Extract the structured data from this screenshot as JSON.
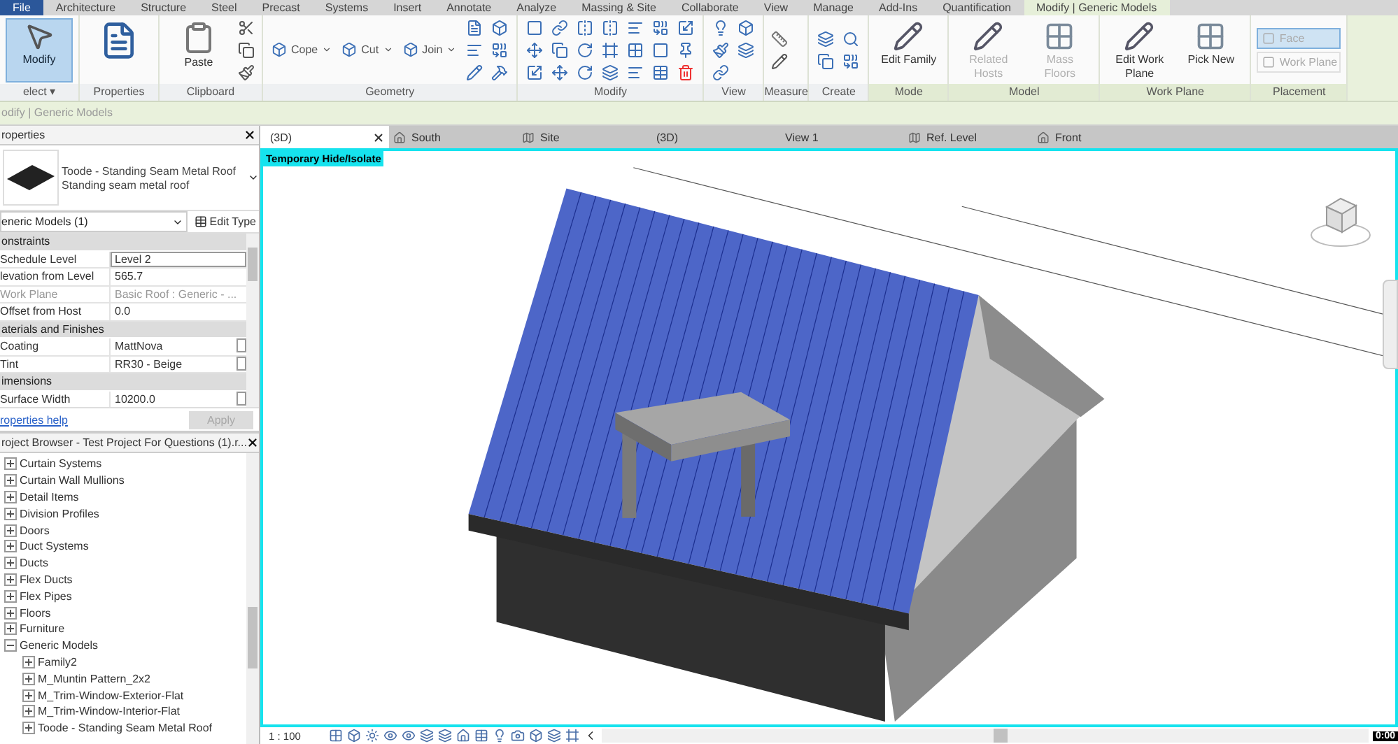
{
  "menu_tabs": [
    {
      "label": "File",
      "kind": "file",
      "selected": false
    },
    {
      "label": "Architecture",
      "kind": "tab",
      "selected": false
    },
    {
      "label": "Structure",
      "kind": "tab",
      "selected": false
    },
    {
      "label": "Steel",
      "kind": "tab",
      "selected": false
    },
    {
      "label": "Precast",
      "kind": "tab",
      "selected": false
    },
    {
      "label": "Systems",
      "kind": "tab",
      "selected": false
    },
    {
      "label": "Insert",
      "kind": "tab",
      "selected": false
    },
    {
      "label": "Annotate",
      "kind": "tab",
      "selected": false
    },
    {
      "label": "Analyze",
      "kind": "tab",
      "selected": false
    },
    {
      "label": "Massing & Site",
      "kind": "tab",
      "selected": false
    },
    {
      "label": "Collaborate",
      "kind": "tab",
      "selected": false
    },
    {
      "label": "View",
      "kind": "tab",
      "selected": false
    },
    {
      "label": "Manage",
      "kind": "tab",
      "selected": false
    },
    {
      "label": "Add-Ins",
      "kind": "tab",
      "selected": false
    },
    {
      "label": "Quantification",
      "kind": "tab",
      "selected": false
    },
    {
      "label": "Modify | Generic Models",
      "kind": "tab",
      "selected": true
    }
  ],
  "ribbon": {
    "panels": [
      {
        "label": "elect ▾",
        "kind": "select",
        "contextual": false,
        "buttons": [
          {
            "kind": "large",
            "label": "Modify",
            "selected": true,
            "disabled": false
          }
        ]
      },
      {
        "label": "Properties",
        "kind": "properties",
        "contextual": false
      },
      {
        "label": "Clipboard",
        "kind": "clipboard",
        "contextual": false,
        "buttons": [
          {
            "kind": "large",
            "label": "Paste",
            "selected": false,
            "disabled": false
          }
        ]
      },
      {
        "label": "Geometry",
        "kind": "geometry",
        "contextual": false,
        "buttons": [
          {
            "kind": "small",
            "label": "Cope"
          },
          {
            "kind": "small",
            "label": "Cut"
          },
          {
            "kind": "small",
            "label": "Join"
          }
        ]
      },
      {
        "label": "Modify",
        "kind": "modify",
        "contextual": false
      },
      {
        "label": "View",
        "kind": "view",
        "contextual": false
      },
      {
        "label": "Measure",
        "kind": "measure",
        "contextual": false
      },
      {
        "label": "Create",
        "kind": "create",
        "contextual": false
      },
      {
        "label": "Mode",
        "kind": "plain",
        "contextual": true,
        "buttons": [
          {
            "kind": "large",
            "label": "Edit Family",
            "selected": false,
            "disabled": false
          }
        ]
      },
      {
        "label": "Model",
        "kind": "plain",
        "contextual": true,
        "buttons": [
          {
            "kind": "large",
            "label": "Related Hosts",
            "selected": false,
            "disabled": true
          },
          {
            "kind": "large",
            "label": "Mass Floors",
            "selected": false,
            "disabled": true
          }
        ]
      },
      {
        "label": "Work Plane",
        "kind": "plain",
        "contextual": true,
        "buttons": [
          {
            "kind": "large",
            "label": "Edit Work Plane",
            "selected": false,
            "disabled": false
          },
          {
            "kind": "large",
            "label": "Pick New",
            "selected": false,
            "disabled": false
          }
        ]
      },
      {
        "label": "Placement",
        "kind": "plain",
        "contextual": true,
        "buttons": [
          {
            "kind": "toggle",
            "label": "Face",
            "selected": true,
            "disabled": true
          },
          {
            "kind": "toggle",
            "label": "Work Plane",
            "selected": false,
            "disabled": true
          }
        ]
      }
    ]
  },
  "context_bar": "odify | Generic Models",
  "properties": {
    "title": "roperties",
    "type_name": "Toode - Standing Seam Metal Roof",
    "type_sub": "Standing seam metal roof",
    "filter": "eneric Models (1)",
    "edit_type": "Edit Type",
    "rows": [
      {
        "kind": "group",
        "label": "onstraints"
      },
      {
        "kind": "param",
        "label": "Schedule Level",
        "value": "Level 2",
        "focused": true,
        "disabled": false
      },
      {
        "kind": "param",
        "label": "levation from Level",
        "value": "565.7",
        "focused": false,
        "disabled": false
      },
      {
        "kind": "param",
        "label": "Work Plane",
        "value": "Basic Roof : Generic - ...",
        "focused": false,
        "disabled": true
      },
      {
        "kind": "param",
        "label": "Offset from Host",
        "value": "0.0",
        "focused": false,
        "disabled": false
      },
      {
        "kind": "group",
        "label": "aterials and Finishes"
      },
      {
        "kind": "param",
        "label": "Coating",
        "value": "MattNova",
        "focused": false,
        "disabled": false,
        "button": true
      },
      {
        "kind": "param",
        "label": "Tint",
        "value": "RR30 - Beige",
        "focused": false,
        "disabled": false,
        "button": true
      },
      {
        "kind": "group",
        "label": "imensions"
      },
      {
        "kind": "param",
        "label": "Surface Width",
        "value": "10200.0",
        "focused": false,
        "disabled": false,
        "button": true
      }
    ],
    "help": "roperties help",
    "apply": "Apply"
  },
  "browser": {
    "title": "roject Browser - Test Project For Questions (1).r...",
    "items": [
      {
        "label": "Curtain Systems",
        "expanded": false
      },
      {
        "label": "Curtain Wall Mullions",
        "expanded": false
      },
      {
        "label": "Detail Items",
        "expanded": false
      },
      {
        "label": "Division Profiles",
        "expanded": false
      },
      {
        "label": "Doors",
        "expanded": false
      },
      {
        "label": "Duct Systems",
        "expanded": false
      },
      {
        "label": "Ducts",
        "expanded": false
      },
      {
        "label": "Flex Ducts",
        "expanded": false
      },
      {
        "label": "Flex Pipes",
        "expanded": false
      },
      {
        "label": "Floors",
        "expanded": false
      },
      {
        "label": "Furniture",
        "expanded": false
      },
      {
        "label": "Generic Models",
        "expanded": true,
        "children": [
          {
            "label": "Family2",
            "expanded": false
          },
          {
            "label": "M_Muntin Pattern_2x2",
            "expanded": false
          },
          {
            "label": "M_Trim-Window-Exterior-Flat",
            "expanded": false
          },
          {
            "label": "M_Trim-Window-Interior-Flat",
            "expanded": false
          },
          {
            "label": "Toode - Standing Seam Metal Roof",
            "expanded": false
          }
        ]
      }
    ]
  },
  "view_tabs": [
    {
      "label": "(3D)",
      "kind": "model",
      "selected": true,
      "closable": true
    },
    {
      "label": "South",
      "kind": "elevation",
      "selected": false
    },
    {
      "label": "Site",
      "kind": "plan",
      "selected": false
    },
    {
      "label": "(3D)",
      "kind": "model",
      "selected": false
    },
    {
      "label": "View 1",
      "kind": "model",
      "selected": false
    },
    {
      "label": "Ref. Level",
      "kind": "plan",
      "selected": false
    },
    {
      "label": "Front",
      "kind": "elevation",
      "selected": false
    }
  ],
  "viewport": {
    "badge": "Temporary Hide/Isolate",
    "scale": "1 : 100",
    "timestamp": "0:00"
  }
}
